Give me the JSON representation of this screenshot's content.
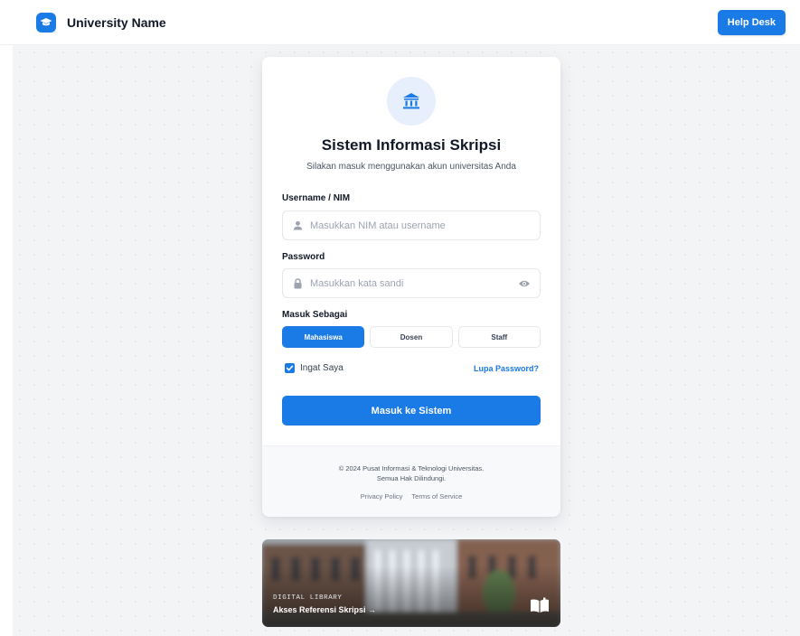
{
  "header": {
    "brand_name": "University Name",
    "help_label": "Help Desk",
    "logo_icon": "graduation-cap-icon"
  },
  "login": {
    "emblem_icon": "university-building-icon",
    "title": "Sistem Informasi Skripsi",
    "subtitle": "Silakan masuk menggunakan akun universitas Anda",
    "username": {
      "label": "Username / NIM",
      "placeholder": "Masukkan NIM atau username",
      "value": "",
      "icon": "user-icon"
    },
    "password": {
      "label": "Password",
      "placeholder": "Masukkan kata sandi",
      "value": "",
      "icon": "lock-icon",
      "toggle_icon": "eye-icon"
    },
    "role": {
      "label": "Masuk Sebagai",
      "options": [
        "Mahasiswa",
        "Dosen",
        "Staff"
      ],
      "selected": "Mahasiswa"
    },
    "remember_label": "Ingat Saya",
    "remember_checked": true,
    "forgot_label": "Lupa Password?",
    "submit_label": "Masuk ke Sistem"
  },
  "footer": {
    "copyright_line1": "© 2024 Pusat Informasi & Teknologi Universitas.",
    "copyright_line2": "Semua Hak Dilindungi.",
    "links": [
      "Privacy Policy",
      "Terms of Service"
    ]
  },
  "library_banner": {
    "eyebrow": "DIGITAL LIBRARY",
    "title": "Akses Referensi Skripsi →",
    "icon": "open-book-icon"
  },
  "colors": {
    "accent": "#1a7ae6",
    "background": "#f3f4f6",
    "emblem_bg": "#e6effb"
  }
}
